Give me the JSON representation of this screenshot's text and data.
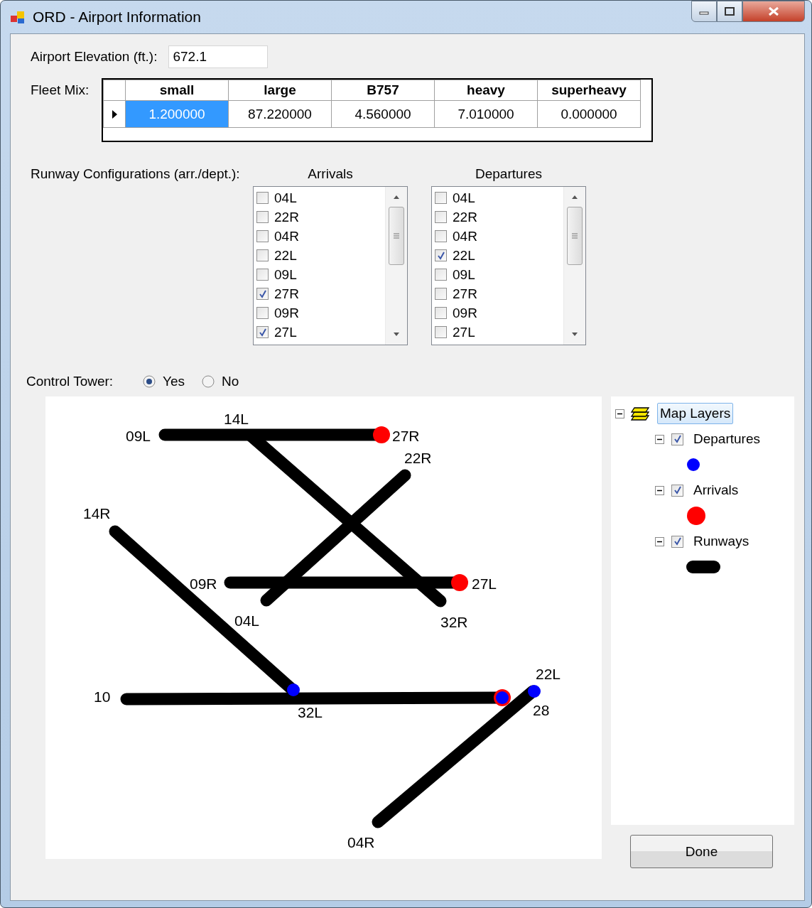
{
  "window": {
    "title": "ORD - Airport Information"
  },
  "elevation": {
    "label": "Airport Elevation (ft.):",
    "value": "672.1"
  },
  "fleet_mix": {
    "label": "Fleet Mix:",
    "columns": [
      "small",
      "large",
      "B757",
      "heavy",
      "superheavy"
    ],
    "rows": [
      {
        "current": true,
        "cells": [
          {
            "text": "1.200000",
            "selected": true
          },
          {
            "text": "87.220000",
            "selected": false
          },
          {
            "text": "4.560000",
            "selected": false
          },
          {
            "text": "7.010000",
            "selected": false
          },
          {
            "text": "0.000000",
            "selected": false
          }
        ]
      }
    ]
  },
  "runway_configurations": {
    "label": "Runway Configurations (arr./dept.):",
    "lists": [
      {
        "title": "Arrivals",
        "items": [
          {
            "label": "04L",
            "checked": false
          },
          {
            "label": "22R",
            "checked": false
          },
          {
            "label": "04R",
            "checked": false
          },
          {
            "label": "22L",
            "checked": false
          },
          {
            "label": "09L",
            "checked": false
          },
          {
            "label": "27R",
            "checked": true
          },
          {
            "label": "09R",
            "checked": false
          },
          {
            "label": "27L",
            "checked": true
          }
        ]
      },
      {
        "title": "Departures",
        "items": [
          {
            "label": "04L",
            "checked": false
          },
          {
            "label": "22R",
            "checked": false
          },
          {
            "label": "04R",
            "checked": false
          },
          {
            "label": "22L",
            "checked": true
          },
          {
            "label": "09L",
            "checked": false
          },
          {
            "label": "27R",
            "checked": false
          },
          {
            "label": "09R",
            "checked": false
          },
          {
            "label": "27L",
            "checked": false
          }
        ]
      }
    ]
  },
  "control_tower": {
    "label": "Control Tower:",
    "options": [
      {
        "label": "Yes",
        "selected": true
      },
      {
        "label": "No",
        "selected": false
      }
    ]
  },
  "map": {
    "runway_labels": [
      "09L",
      "14L",
      "27R",
      "22R",
      "14R",
      "09R",
      "27L",
      "04L",
      "32R",
      "10",
      "32L",
      "22L",
      "28",
      "04R"
    ]
  },
  "layers": {
    "label": "Map Layers",
    "expanded": true,
    "selected": true,
    "children": [
      {
        "kind": "departures",
        "label": "Departures",
        "checked": true,
        "expanded": true,
        "color": "#0000ff"
      },
      {
        "kind": "arrivals",
        "label": "Arrivals",
        "checked": true,
        "expanded": true,
        "color": "#ff0000"
      },
      {
        "kind": "runways",
        "label": "Runways",
        "checked": true,
        "expanded": true,
        "color": "#000000"
      }
    ]
  },
  "buttons": [
    "Done"
  ]
}
